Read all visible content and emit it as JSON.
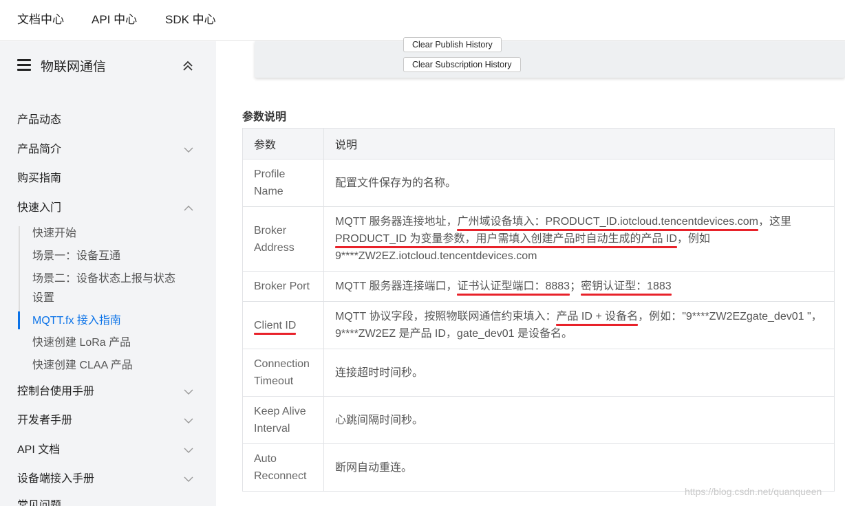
{
  "topnav": [
    "文档中心",
    "API 中心",
    "SDK 中心"
  ],
  "sidebar": {
    "title": "物联网通信",
    "items": [
      {
        "label": "产品动态"
      },
      {
        "label": "产品简介"
      },
      {
        "label": "购买指南"
      },
      {
        "label": "快速入门"
      },
      {
        "label": "控制台使用手册"
      },
      {
        "label": "开发者手册"
      },
      {
        "label": "API 文档"
      },
      {
        "label": "设备端接入手册"
      },
      {
        "label": "常见问题"
      }
    ],
    "subitems": [
      {
        "label": "快速开始"
      },
      {
        "label": "场景一：设备互通"
      },
      {
        "label": "场景二：设备状态上报与状态设置"
      },
      {
        "label": "MQTT.fx 接入指南"
      },
      {
        "label": "快速创建 LoRa 产品"
      },
      {
        "label": "快速创建 CLAA 产品"
      }
    ]
  },
  "screenshot": {
    "buttons": [
      "Clear Publish History",
      "Clear Subscription History"
    ]
  },
  "section_title": "参数说明",
  "table": {
    "headers": [
      "参数",
      "说明"
    ],
    "rows": [
      {
        "param": "Profile Name",
        "desc": "配置文件保存为的名称。"
      },
      {
        "param": "Broker Address",
        "desc_parts": [
          "MQTT 服务器连接地址，",
          "广州域设备填入：PRODUCT_ID.iotcloud.tencentdevices.com",
          "，这里",
          "PRODUCT_ID 为变量参数，用户需填入创建产品时自动生成的产品 ID",
          "，例如 9****ZW2EZ.iotcloud.tencentdevices.com"
        ]
      },
      {
        "param": "Broker Port",
        "desc_parts": [
          "MQTT 服务器连接端口，",
          "证书认证型端口：8883",
          "；",
          "密钥认证型：1883"
        ]
      },
      {
        "param": "Client ID",
        "desc_parts": [
          "MQTT 协议字段，按照物联网通信约束填入：",
          "产品 ID + 设备名",
          "，例如：",
          "\"9****ZW2EZgate_dev01 \"，9****ZW2EZ 是产品 ID，gate_dev01 是设备名。"
        ]
      },
      {
        "param": "Connection Timeout",
        "desc": "连接超时时间秒。"
      },
      {
        "param": "Keep Alive Interval",
        "desc": "心跳间隔时间秒。"
      },
      {
        "param": "Auto Reconnect",
        "desc": "断网自动重连。"
      }
    ]
  },
  "watermark": "https://blog.csdn.net/quanqueen",
  "colors": {
    "accent": "#0a72e8",
    "underline": "#e8222a",
    "sidebar_bg": "#f3f4f6"
  }
}
